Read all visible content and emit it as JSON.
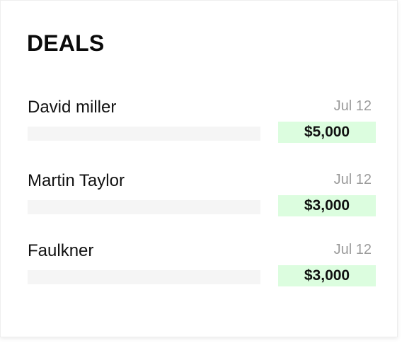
{
  "panel": {
    "title": "DEALS"
  },
  "deals": [
    {
      "name": "David miller",
      "date": "Jul 12",
      "amount": "$5,000"
    },
    {
      "name": "Martin Taylor",
      "date": "Jul 12",
      "amount": "$3,000"
    },
    {
      "name": "Faulkner",
      "date": "Jul 12",
      "amount": "$3,000"
    }
  ],
  "colors": {
    "amount_background": "#dcfddf",
    "bar_background": "#f5f5f5",
    "date_text": "#9b9b9b"
  }
}
